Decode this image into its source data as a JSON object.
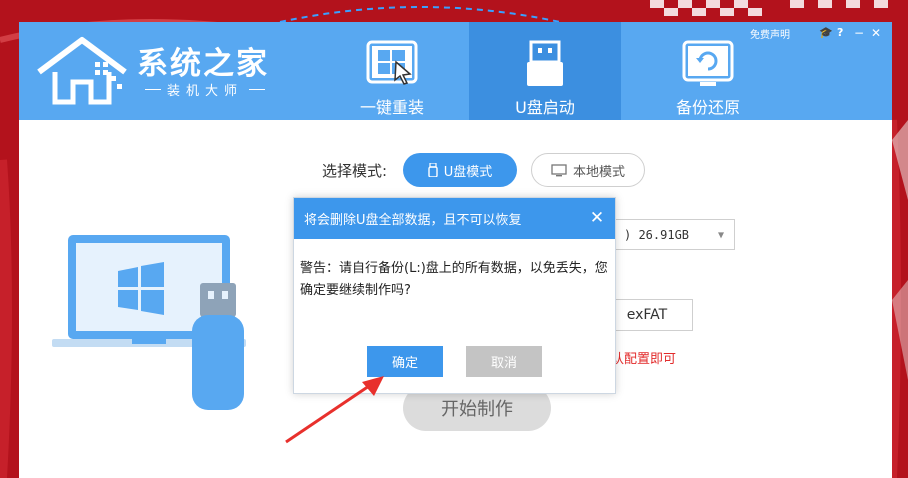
{
  "app": {
    "title": "系统之家",
    "subtitle": "装机大师",
    "top_links": {
      "disclaimer": "免费声明"
    }
  },
  "tabs": [
    {
      "label": "一键重装",
      "icon": "windows-reinstall-icon",
      "active": false
    },
    {
      "label": "U盘启动",
      "icon": "usb-drive-icon",
      "active": true
    },
    {
      "label": "备份还原",
      "icon": "backup-restore-icon",
      "active": false
    }
  ],
  "mode": {
    "label": "选择模式:",
    "usb_mode": "U盘模式",
    "local_mode": "本地模式",
    "selected": "U盘模式"
  },
  "device_select": {
    "value_fragment": ") 26.91GB"
  },
  "filesystem": {
    "value": "exFAT"
  },
  "hint_text": "认配置即可",
  "start_button": "开始制作",
  "dialog": {
    "title": "将会删除U盘全部数据，且不可以恢复",
    "message": "警告：请自行备份(L:)盘上的所有数据，以免丢失，您确定要继续制作吗?",
    "ok_label": "确定",
    "cancel_label": "取消"
  },
  "colors": {
    "header_blue": "#58a8f1",
    "active_tab_blue": "#3c8fe0",
    "accent_blue": "#3d97ec",
    "background_red": "#b3121c",
    "warning_red": "#e22b2b"
  }
}
